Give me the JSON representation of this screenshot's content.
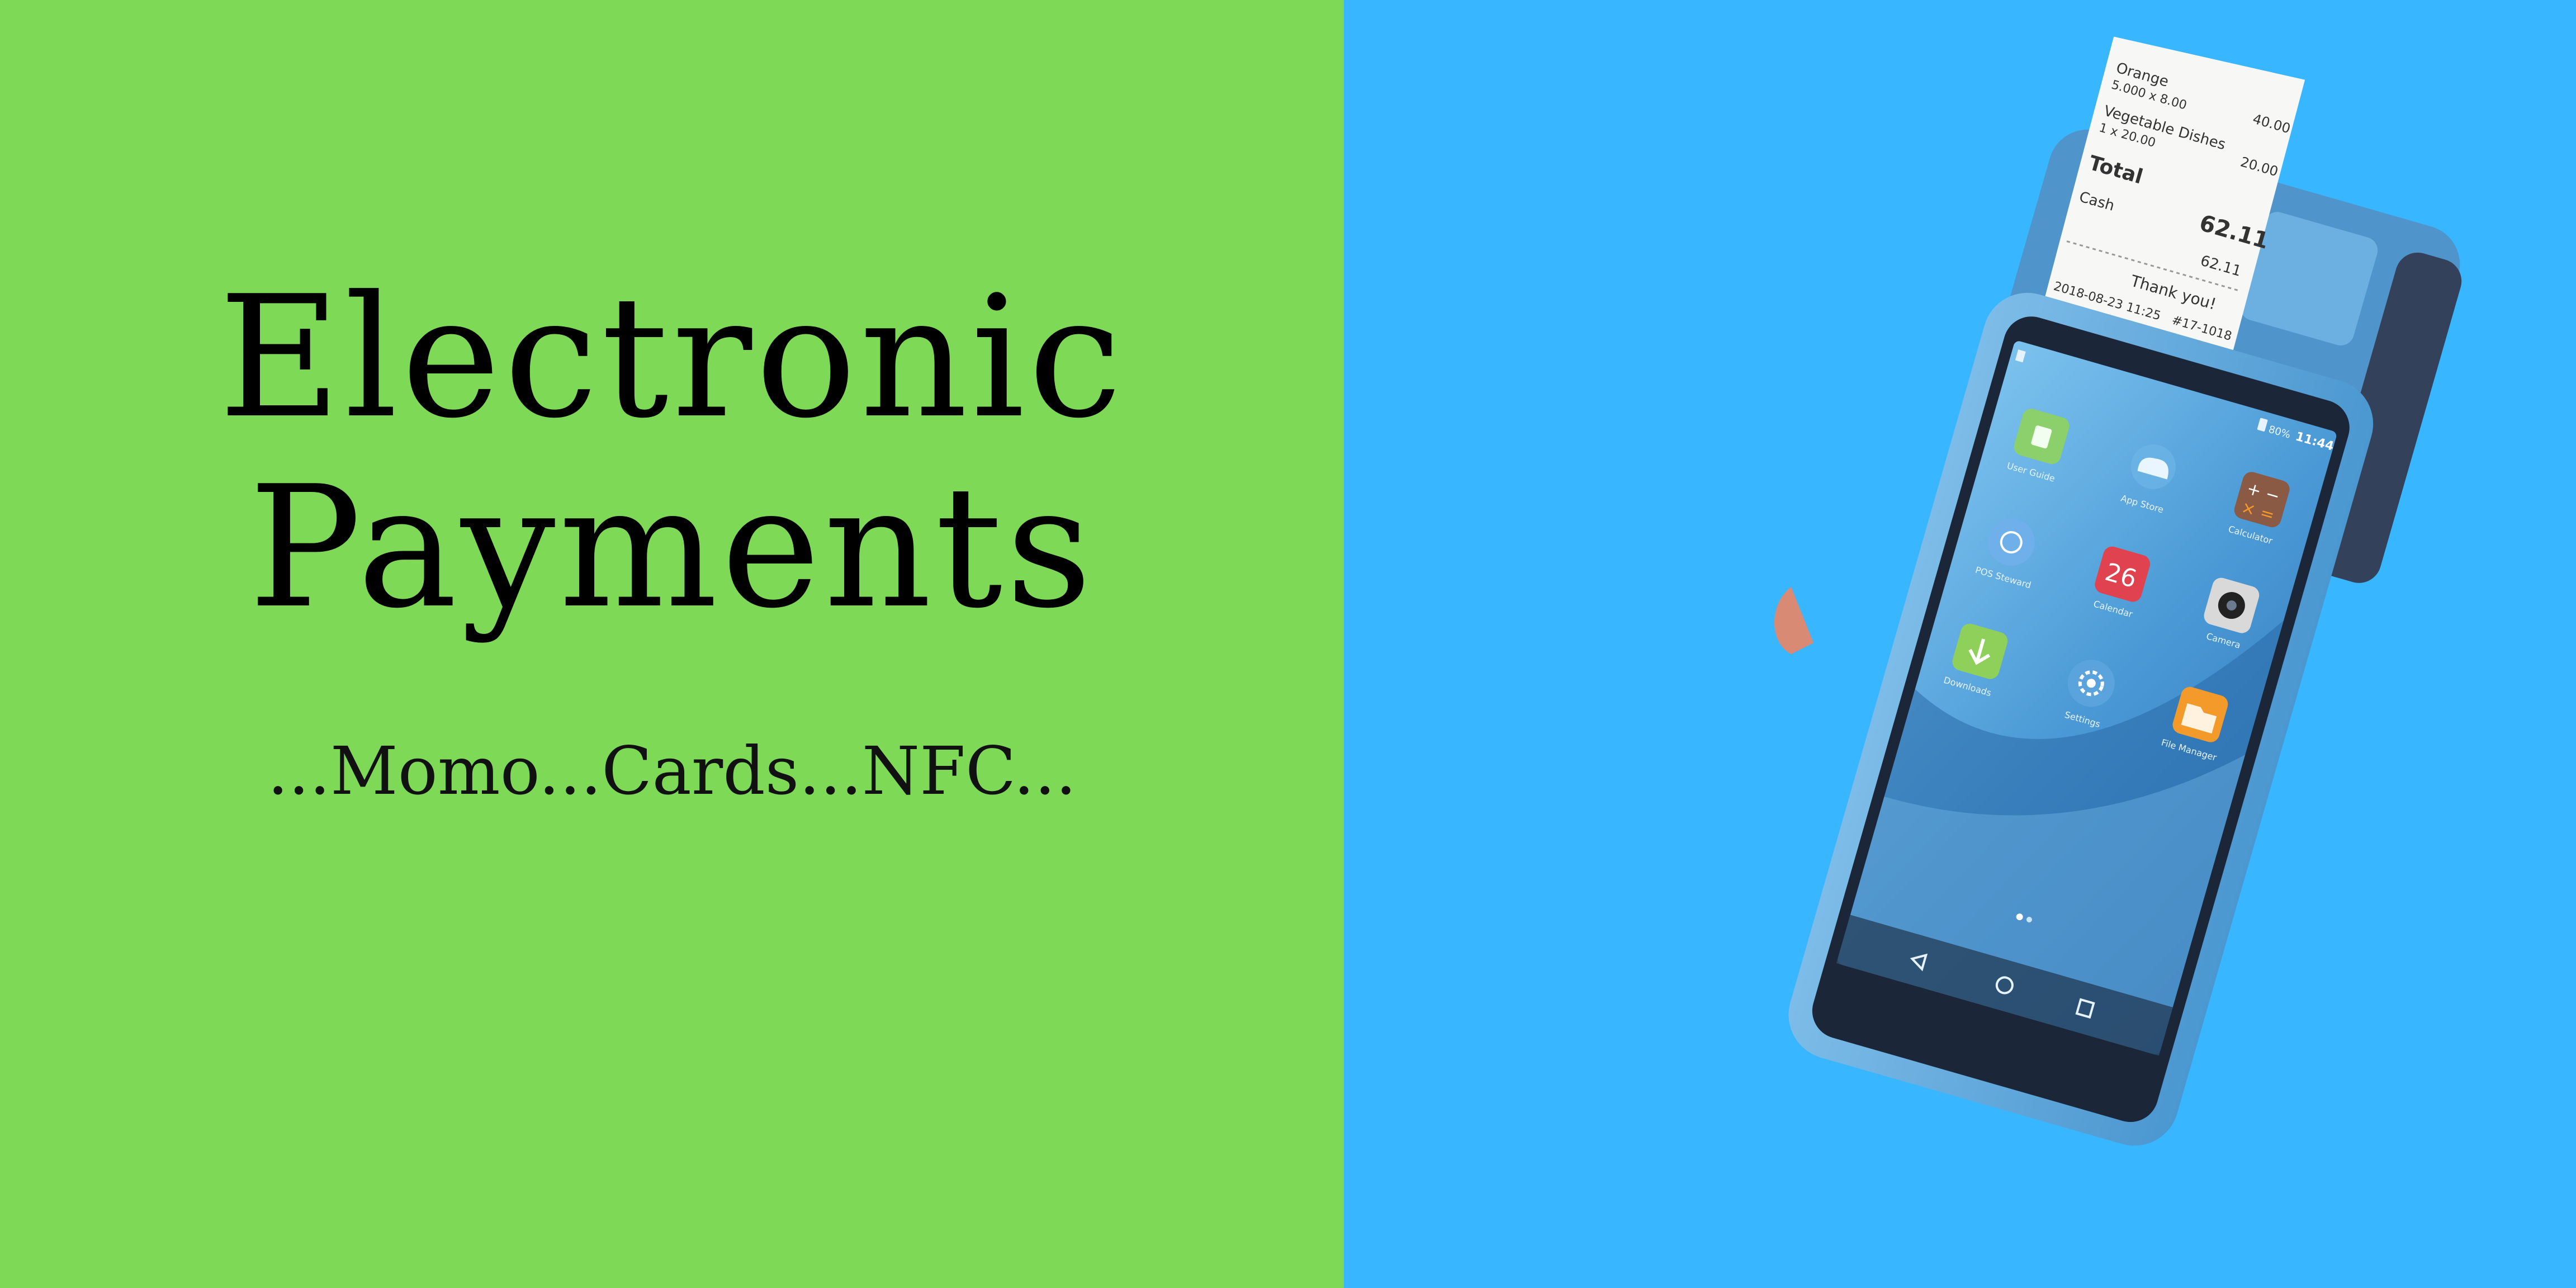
{
  "colors": {
    "left_bg": "#7ed957",
    "right_bg": "#38b6ff",
    "device_blue": "#5aa9e0"
  },
  "headline": {
    "line1": "Electronic",
    "line2": "Payments"
  },
  "subtitle": "...Momo...Cards...NFC...",
  "receipt": {
    "items": [
      {
        "name": "Orange",
        "qty": "5.000 x 8.00",
        "amount": "40.00"
      },
      {
        "name": "Vegetable Dishes",
        "qty": "1 x 20.00",
        "amount": "20.00"
      }
    ],
    "total_label": "Total",
    "total_value": "62.11",
    "cash_label": "Cash",
    "cash_value": "62.11",
    "thanks": "Thank you!",
    "date": "2018-08-23 11:25",
    "ref": "#17-1018"
  },
  "status_bar": {
    "battery": "80%",
    "time": "11:44"
  },
  "apps": [
    {
      "label": "User Guide",
      "icon": "user-guide-icon",
      "color": "#8bd06a"
    },
    {
      "label": "App Store",
      "icon": "cloud-icon",
      "color": "#6fb7e8"
    },
    {
      "label": "Calculator",
      "icon": "calculator-icon",
      "color": "#8a5a44"
    },
    {
      "label": "POS Steward",
      "icon": "pos-steward-icon",
      "color": "#6fb0ea"
    },
    {
      "label": "Calendar",
      "icon": "calendar-icon",
      "color": "#e0424f",
      "badge": "26"
    },
    {
      "label": "Camera",
      "icon": "camera-icon",
      "color": "#d9d9d9"
    },
    {
      "label": "Downloads",
      "icon": "download-icon",
      "color": "#8fd05a"
    },
    {
      "label": "Settings",
      "icon": "gear-icon",
      "color": "#5aa3dd"
    },
    {
      "label": "File Manager",
      "icon": "folder-icon",
      "color": "#f39a2a"
    }
  ]
}
